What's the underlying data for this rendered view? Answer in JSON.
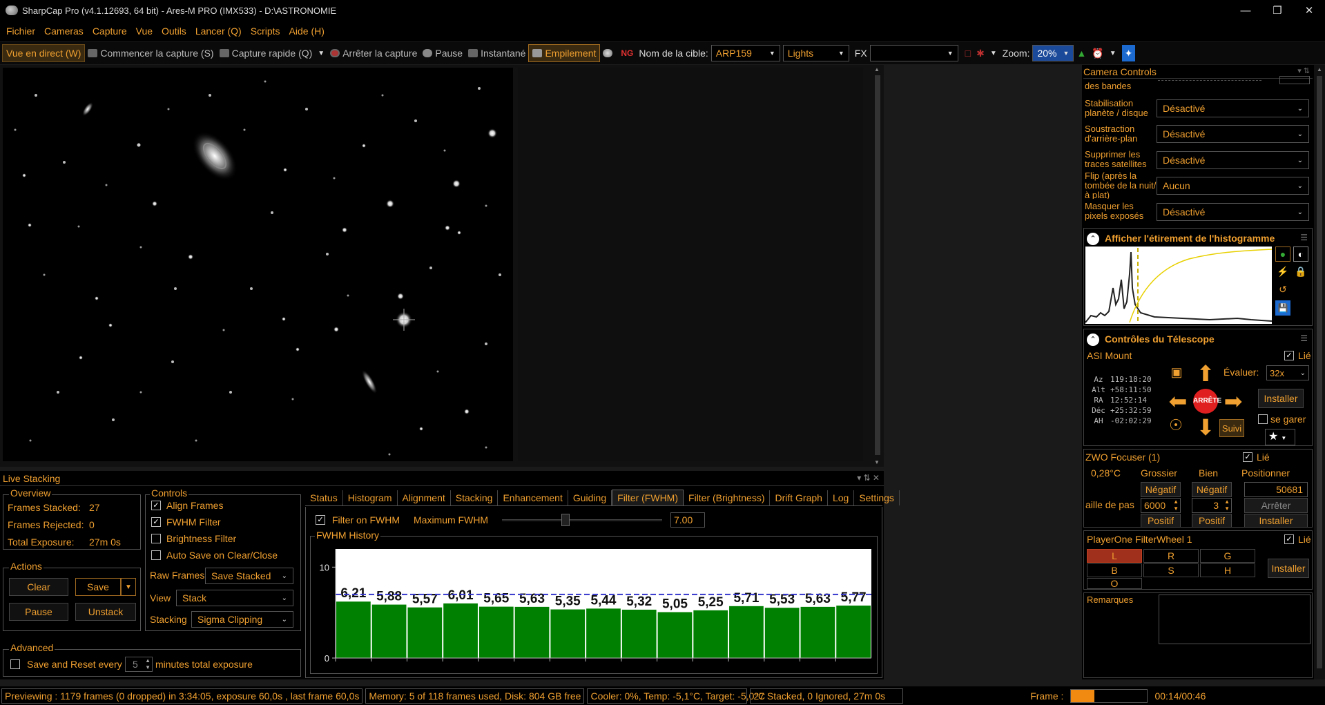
{
  "window": {
    "title": "SharpCap Pro (v4.1.12693, 64 bit) - Ares-M PRO (IMX533) - D:\\ASTRONOMIE"
  },
  "menu": [
    "Fichier",
    "Cameras",
    "Capture",
    "Vue",
    "Outils",
    "Lancer (Q)",
    "Scripts",
    "Aide (H)"
  ],
  "toolbar": {
    "live": "Vue en direct (W)",
    "start_capture": "Commencer la capture (S)",
    "quick_capture": "Capture rapide (Q)",
    "stop_capture": "Arrêter la capture",
    "pause": "Pause",
    "snapshot": "Instantané",
    "stacking": "Empilement",
    "target_label": "Nom de la cible:",
    "target_value": "ARP159",
    "frame_type": "Lights",
    "fx_label": "FX",
    "zoom_label": "Zoom:",
    "zoom_value": "20%"
  },
  "camera_controls": {
    "title": "Camera Controls",
    "partial_label": "des bandes",
    "rows": [
      {
        "label": "Stabilisation planète / disque",
        "value": "Désactivé"
      },
      {
        "label": "Soustraction d'arrière-plan",
        "value": "Désactivé"
      },
      {
        "label": "Supprimer les traces satellites",
        "value": "Désactivé"
      },
      {
        "label": "Flip (après la tombée de la nuit/à plat)",
        "value": "Aucun"
      },
      {
        "label": "Masquer les pixels exposés",
        "value": "Désactivé"
      }
    ]
  },
  "histogram": {
    "title": "Afficher l'étirement de l'histogramme"
  },
  "telescope": {
    "title": "Contrôles du Télescope",
    "mount": "ASI Mount",
    "linked": "Lié",
    "rate_label": "Évaluer:",
    "rate_value": "32x",
    "coords": [
      {
        "k": "Az",
        "v": "119:18:20"
      },
      {
        "k": "Alt",
        "v": "+58:11:50"
      },
      {
        "k": "RA",
        "v": "12:52:14"
      },
      {
        "k": "Déc",
        "v": "+25:32:59"
      },
      {
        "k": "AH",
        "v": "-02:02:29"
      }
    ],
    "stop": "ARRÊTE",
    "install": "Installer",
    "park": "se garer",
    "track": "Suivi"
  },
  "focuser": {
    "title": "ZWO Focuser (1)",
    "linked": "Lié",
    "temp": "0,28°C",
    "coarse": "Grossier",
    "fine": "Bien",
    "position": "Positionner",
    "neg": "Négatif",
    "pos": "Positif",
    "position_value": "50681",
    "step_label": "aille de pas",
    "coarse_step": "6000",
    "fine_step": "3",
    "stop": "Arrêter",
    "install": "Installer"
  },
  "filterwheel": {
    "title": "PlayerOne FilterWheel 1",
    "linked": "Lié",
    "filters": [
      "L",
      "R",
      "G",
      "B",
      "S",
      "H",
      "O"
    ],
    "install": "Installer"
  },
  "notes": {
    "title": "Remarques"
  },
  "live_stacking": {
    "title": "Live Stacking",
    "overview": {
      "title": "Overview",
      "stacked_label": "Frames Stacked:",
      "stacked": "27",
      "rejected_label": "Frames Rejected:",
      "rejected": "0",
      "exposure_label": "Total Exposure:",
      "exposure": "27m 0s"
    },
    "actions": {
      "title": "Actions",
      "clear": "Clear",
      "save": "Save",
      "pause": "Pause",
      "unstack": "Unstack"
    },
    "controls": {
      "title": "Controls",
      "align": "Align Frames",
      "fwhm": "FWHM Filter",
      "brightness": "Brightness Filter",
      "autosave": "Auto Save on Clear/Close",
      "raw_label": "Raw Frames",
      "raw_value": "Save Stacked",
      "view_label": "View",
      "view_value": "Stack",
      "stacking_label": "Stacking",
      "stacking_value": "Sigma Clipping"
    },
    "advanced": {
      "title": "Advanced",
      "save_reset": "Save and Reset every",
      "minutes": "5",
      "suffix": "minutes total exposure"
    },
    "tabs": [
      "Status",
      "Histogram",
      "Alignment",
      "Stacking",
      "Enhancement",
      "Guiding",
      "Filter (FWHM)",
      "Filter (Brightness)",
      "Drift Graph",
      "Log",
      "Settings"
    ],
    "selected_tab": "Filter (FWHM)",
    "filter_fwhm": {
      "enable": "Filter on FWHM",
      "max_label": "Maximum FWHM",
      "max_value": "7.00",
      "history_title": "FWHM History"
    }
  },
  "chart_data": {
    "type": "bar",
    "title": "FWHM History",
    "values": [
      6.21,
      5.88,
      5.57,
      6.01,
      5.65,
      5.63,
      5.35,
      5.44,
      5.32,
      5.05,
      5.25,
      5.71,
      5.53,
      5.63,
      5.77
    ],
    "labels": [
      "6,21",
      "5,88",
      "5,57",
      "6,01",
      "5,65",
      "5,63",
      "5,35",
      "5,44",
      "5,32",
      "5,05",
      "5,25",
      "5,71",
      "5,53",
      "5,63",
      "5,77"
    ],
    "threshold": 7.0,
    "ylim": [
      0,
      12
    ],
    "yticks": [
      "10",
      "0"
    ],
    "bar_color": "#008000",
    "threshold_color": "#3333cc"
  },
  "status": {
    "preview": "Previewing : 1179 frames (0 dropped) in 3:34:05, exposure 60,0s , last frame 60,0s",
    "memory": "Memory: 5 of 118 frames used, Disk: 804 GB free",
    "cooler": "Cooler: 0%, Temp: -5,1°C, Target: -5,0°C",
    "stacked": "27 Stacked, 0 Ignored, 27m 0s",
    "frame_label": "Frame :",
    "time": "00:14/00:46"
  },
  "colors": {
    "accent": "#f0a030",
    "background": "#000000"
  }
}
